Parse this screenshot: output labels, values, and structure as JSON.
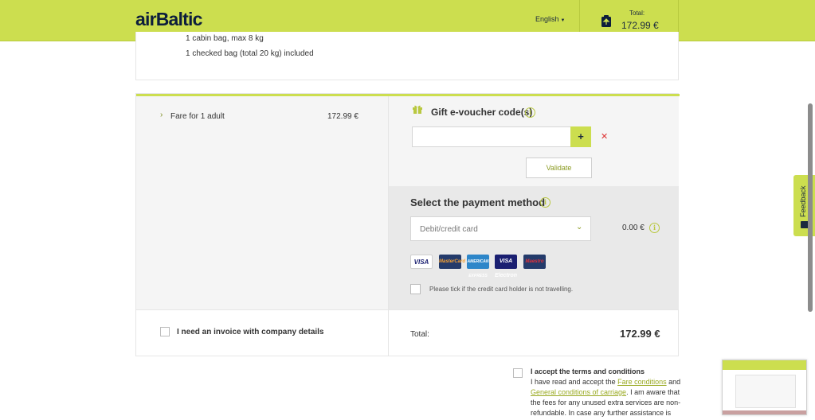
{
  "header": {
    "logo": "airBaltic",
    "language": "English",
    "cart_total_label": "Total:",
    "cart_total_value": "172.99 €"
  },
  "flight_info": {
    "line1": "1 cabin bag, max 8 kg",
    "line2": "1 checked bag (total 20 kg) included"
  },
  "fare": {
    "label": "Fare for 1 adult",
    "price": "172.99 €"
  },
  "voucher": {
    "title": "Gift e-voucher code(s)",
    "input_value": "",
    "add_label": "+",
    "remove_label": "✕",
    "validate_label": "Validate"
  },
  "payment": {
    "title": "Select the payment method",
    "selected_method": "Debit/credit card",
    "fee": "0.00 €",
    "cards": [
      "VISA",
      "MasterCard",
      "AMERICAN EXPRESS",
      "VISA Electron",
      "Maestro"
    ],
    "holder_label": "Please tick if the credit card holder is not travelling."
  },
  "invoice": {
    "label": "I need an invoice with company details"
  },
  "summary": {
    "total_label": "Total:",
    "total_value": "172.99 €"
  },
  "terms": {
    "title": "I accept the terms and conditions",
    "text_start": "I have read and accept the ",
    "fare_conditions_link": "Fare conditions",
    "and": " and ",
    "general_conditions_link": "General conditions of carriage",
    "text_end": ". I am aware that the fees for any unused extra services are non-refundable. In case any further assistance is"
  },
  "feedback": {
    "label": "Feedback"
  },
  "colors": {
    "brand": "#ccde4f",
    "navy": "#0d1e3c",
    "link": "#9aaa22"
  }
}
